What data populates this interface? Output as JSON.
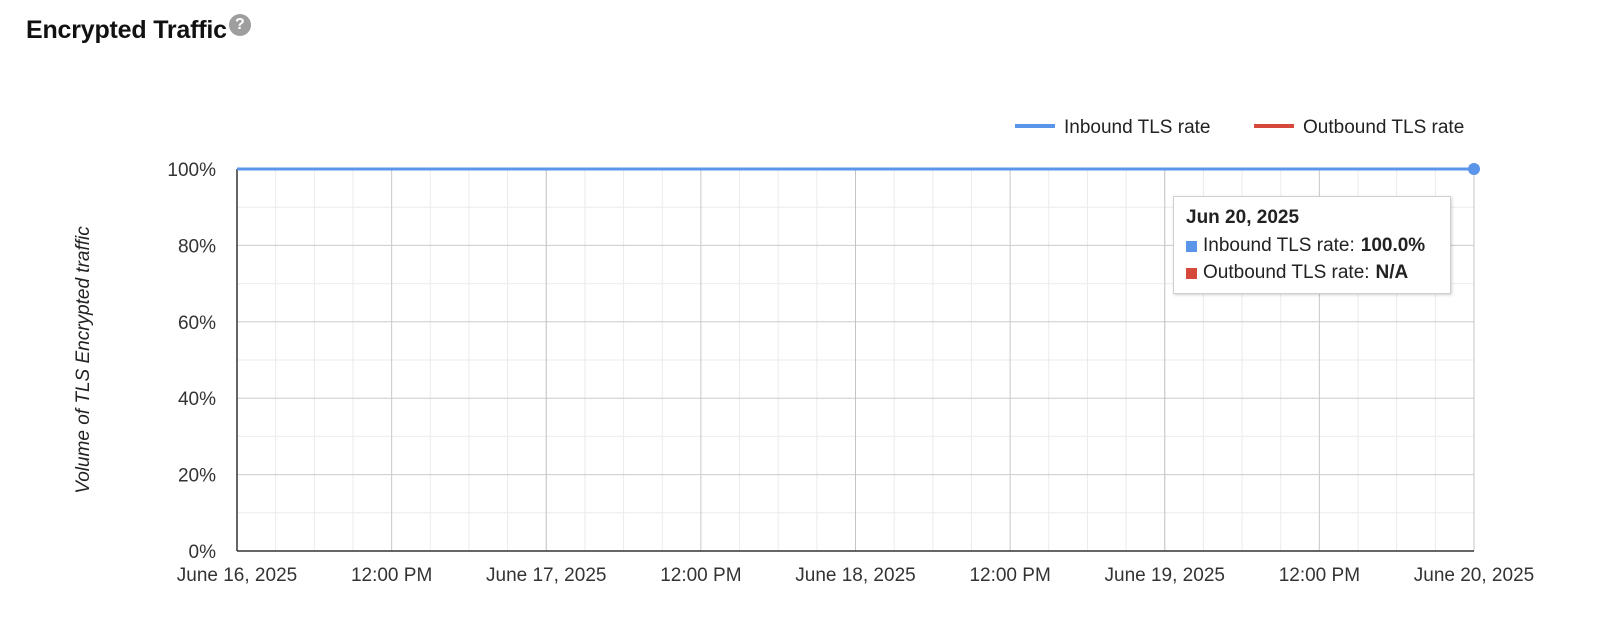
{
  "header": {
    "title": "Encrypted Traffic",
    "help_icon": "question-circle-icon"
  },
  "colors": {
    "inbound": "#5b95e9",
    "outbound": "#d6483a",
    "grid_major": "#cccccc",
    "grid_minor": "#ebebeb",
    "axis": "#333333"
  },
  "tooltip": {
    "date": "Jun 20, 2025",
    "rows": [
      {
        "label": "Inbound TLS rate:",
        "value": "100.0%"
      },
      {
        "label": "Outbound TLS rate:",
        "value": "N/A"
      }
    ]
  },
  "chart_data": {
    "type": "line",
    "title": "Encrypted Traffic",
    "ylabel": "Volume of TLS Encrypted traffic",
    "xlabel": "",
    "ylim": [
      0,
      100
    ],
    "yticks": [
      "0%",
      "20%",
      "40%",
      "60%",
      "80%",
      "100%"
    ],
    "xlim": [
      "2025-06-16",
      "2025-06-20"
    ],
    "xticks": [
      "June 16, 2025",
      "12:00 PM",
      "June 17, 2025",
      "12:00 PM",
      "June 18, 2025",
      "12:00 PM",
      "June 19, 2025",
      "12:00 PM",
      "June 20, 2025"
    ],
    "legend_position": "top-right",
    "grid": true,
    "series": [
      {
        "name": "Inbound TLS rate",
        "x": [
          "2025-06-16",
          "2025-06-17",
          "2025-06-18",
          "2025-06-19",
          "2025-06-20"
        ],
        "values": [
          100,
          100,
          100,
          100,
          100
        ]
      },
      {
        "name": "Outbound TLS rate",
        "x": [],
        "values": []
      }
    ]
  }
}
